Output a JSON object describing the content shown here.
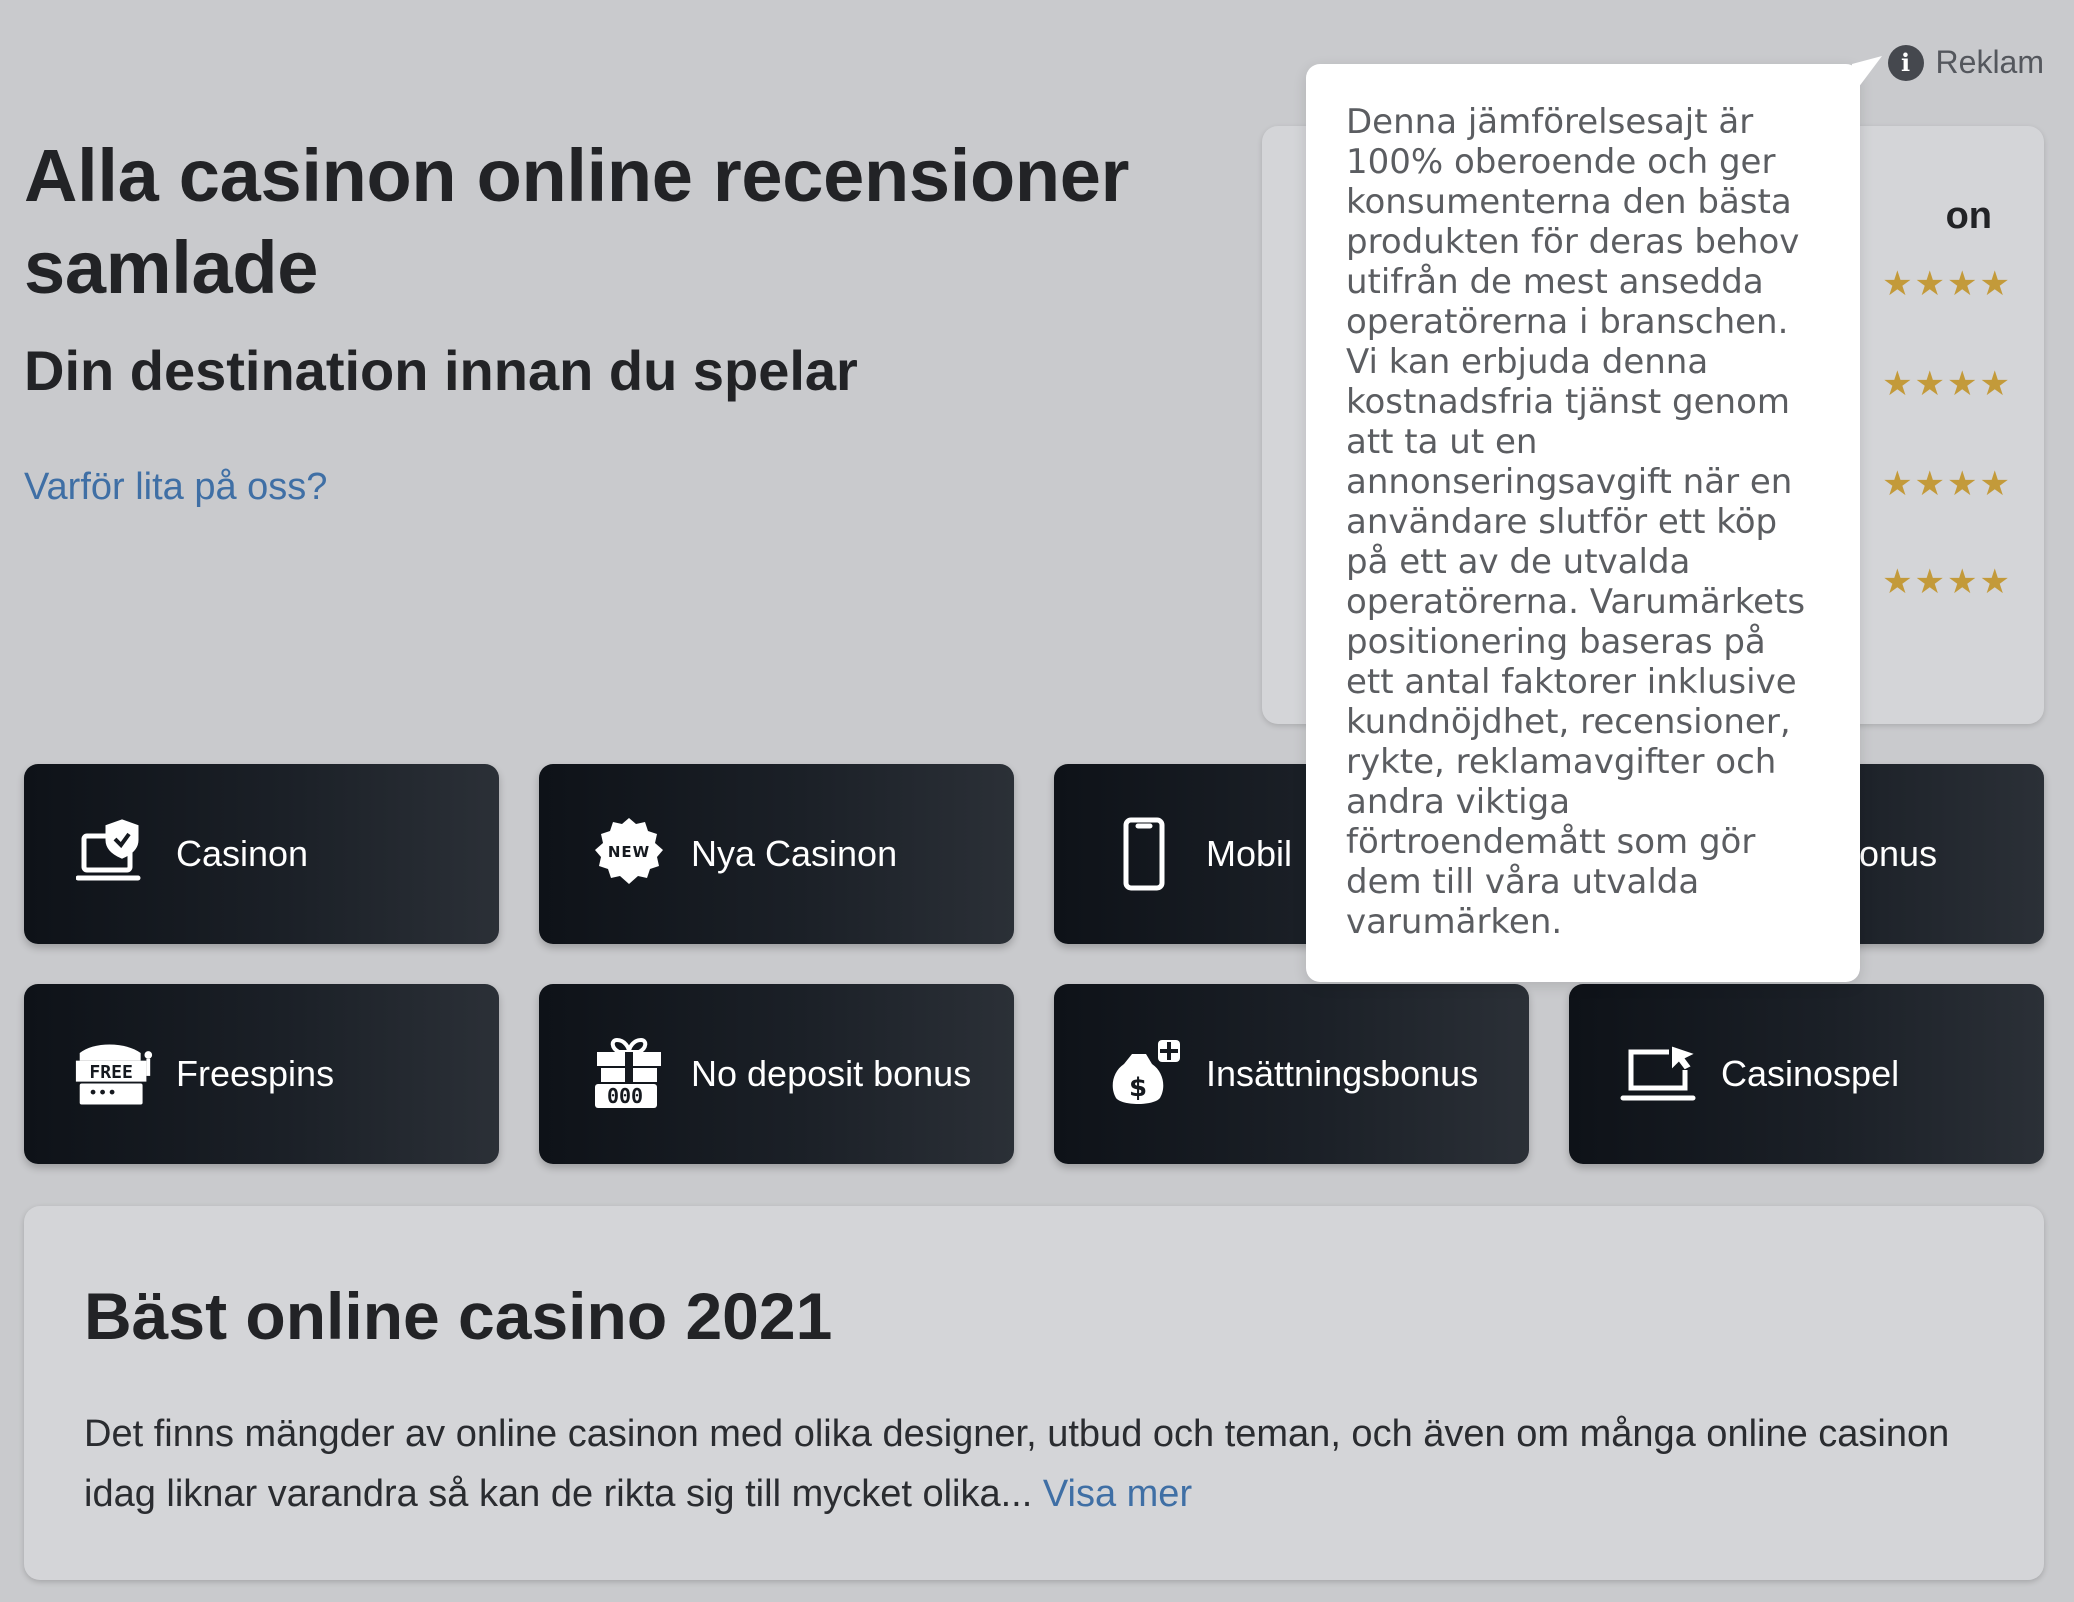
{
  "hero": {
    "title": "Alla casinon online recensioner samlade",
    "subtitle": "Din destination innan du spelar",
    "trust_link": "Varför lita på oss?"
  },
  "ad_notice": {
    "label": "Reklam",
    "icon": "info-icon",
    "tooltip": "Denna jämförelsesajt är 100% oberoende och ger konsumenterna den bästa produkten för deras behov utifrån de mest ansedda operatörerna i branschen. Vi kan erbjuda denna kostnadsfria tjänst genom att ta ut en annonseringsavgift när en användare slutför ett köp på ett av de utvalda operatörerna. Varumärkets positionering baseras på ett antal faktorer inklusive kundnöjdhet, recensioner, rykte, reklamavgifter och andra viktiga förtroendemått som gör dem till våra utvalda varumärken."
  },
  "rating_panel": {
    "title_fragment": "on",
    "rows": [
      {
        "stars": "★★★★"
      },
      {
        "stars": "★★★★"
      },
      {
        "stars": "★★★★"
      },
      {
        "stars": "★★★★"
      }
    ]
  },
  "categories": [
    {
      "label": "Casinon",
      "icon": "laptop-shield-icon"
    },
    {
      "label": "Nya Casinon",
      "icon": "new-badge-icon"
    },
    {
      "label": "Mobil",
      "icon": "mobile-phone-icon"
    },
    {
      "label": "onus",
      "icon": "bonus-icon"
    },
    {
      "label": "Freespins",
      "icon": "free-slot-icon"
    },
    {
      "label": "No deposit bonus",
      "icon": "gift-icon"
    },
    {
      "label": "Insättningsbonus",
      "icon": "money-bag-icon"
    },
    {
      "label": "Casinospel",
      "icon": "laptop-cursor-icon"
    }
  ],
  "intro": {
    "title": "Bäst online casino 2021",
    "text": "Det finns mängder av online casinon med olika designer, utbud och teman, och även om många online casinon idag liknar varandra så kan de rikta sig till mycket olika...",
    "more_link": "Visa mer"
  },
  "colors": {
    "background": "#c9cacd",
    "link": "#3f6fa5",
    "star": "#c39a3a",
    "card_dark": "#0e1218"
  }
}
